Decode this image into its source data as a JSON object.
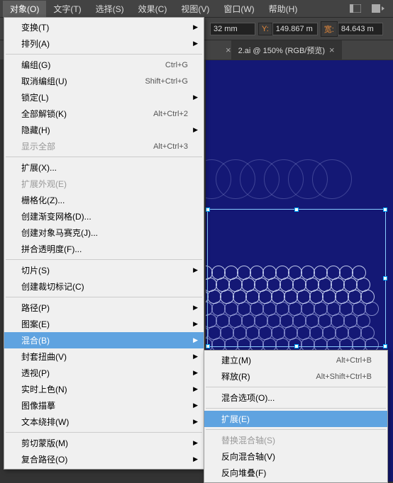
{
  "menubar": {
    "items": [
      "对象(O)",
      "文字(T)",
      "选择(S)",
      "效果(C)",
      "视图(V)",
      "窗口(W)",
      "帮助(H)"
    ]
  },
  "toolbar": {
    "x_val": "32 mm",
    "y_label": "Y:",
    "y_val": "149.867 m",
    "w_label": "宽:",
    "w_val": "84.643 m"
  },
  "tabs": {
    "active": "2.ai @ 150% (RGB/预览)"
  },
  "menu": {
    "items": [
      {
        "t": "变换(T)",
        "arrow": true
      },
      {
        "t": "排列(A)",
        "arrow": true
      },
      {
        "sep": true
      },
      {
        "t": "编组(G)",
        "k": "Ctrl+G"
      },
      {
        "t": "取消编组(U)",
        "k": "Shift+Ctrl+G"
      },
      {
        "t": "锁定(L)",
        "arrow": true
      },
      {
        "t": "全部解锁(K)",
        "k": "Alt+Ctrl+2"
      },
      {
        "t": "隐藏(H)",
        "arrow": true
      },
      {
        "t": "显示全部",
        "k": "Alt+Ctrl+3",
        "dim": true
      },
      {
        "sep": true
      },
      {
        "t": "扩展(X)..."
      },
      {
        "t": "扩展外观(E)",
        "dim": true
      },
      {
        "t": "栅格化(Z)..."
      },
      {
        "t": "创建渐变网格(D)..."
      },
      {
        "t": "创建对象马赛克(J)..."
      },
      {
        "t": "拼合透明度(F)..."
      },
      {
        "sep": true
      },
      {
        "t": "切片(S)",
        "arrow": true
      },
      {
        "t": "创建裁切标记(C)"
      },
      {
        "sep": true
      },
      {
        "t": "路径(P)",
        "arrow": true
      },
      {
        "t": "图案(E)",
        "arrow": true
      },
      {
        "t": "混合(B)",
        "arrow": true,
        "hov": true
      },
      {
        "t": "封套扭曲(V)",
        "arrow": true
      },
      {
        "t": "透视(P)",
        "arrow": true
      },
      {
        "t": "实时上色(N)",
        "arrow": true
      },
      {
        "t": "图像描摹",
        "arrow": true
      },
      {
        "t": "文本绕排(W)",
        "arrow": true
      },
      {
        "sep": true
      },
      {
        "t": "剪切蒙版(M)",
        "arrow": true
      },
      {
        "t": "复合路径(O)",
        "arrow": true
      }
    ]
  },
  "submenu": {
    "items": [
      {
        "t": "建立(M)",
        "k": "Alt+Ctrl+B"
      },
      {
        "t": "释放(R)",
        "k": "Alt+Shift+Ctrl+B"
      },
      {
        "sep": true
      },
      {
        "t": "混合选项(O)..."
      },
      {
        "sep": true
      },
      {
        "t": "扩展(E)",
        "hov": true
      },
      {
        "sep": true
      },
      {
        "t": "替换混合轴(S)",
        "dim": true
      },
      {
        "t": "反向混合轴(V)"
      },
      {
        "t": "反向堆叠(F)"
      }
    ]
  }
}
